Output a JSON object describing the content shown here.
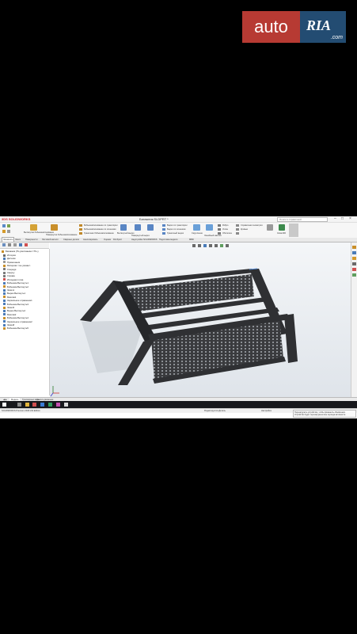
{
  "watermark": {
    "left": "auto",
    "right": "RIA",
    "domain": ".com"
  },
  "window": {
    "app_logo": "3DS SOLIDWORKS",
    "document_title": "Багажник.SLDPRT *",
    "search_placeholder": "Поиск в справочной",
    "controls": [
      "–",
      "□",
      "×"
    ]
  },
  "ribbon": {
    "buttons": [
      "Вытянутая бобышка/основание",
      "Повернутая бобышка/основание",
      "Бобышка/основание по траектории",
      "Бобышка/основание по сечениям",
      "Граничная бобышка/основание",
      "Вытянутый вырез",
      "Повернутый вырез",
      "Вырез по траектории",
      "Вырез по сечениям",
      "Граничный вырез",
      "Скругление",
      "Линейный массив",
      "Ребро",
      "Уклон",
      "Оболочка",
      "Справочная геометрия",
      "Кривые",
      "Instant3D"
    ]
  },
  "tabs": [
    "Элементы",
    "Эскиз",
    "Поверхности",
    "Листовой металл",
    "Сварные детали",
    "Анализировать",
    "Оценка",
    "DimXpert",
    "Надстройки SOLIDWORKS",
    "Подготовка модели",
    "MBD"
  ],
  "active_tab": "Элементы",
  "feature_tree": {
    "root": "Багажник (По умолчанию<<По у",
    "items": [
      "История",
      "Датчики",
      "Примечания",
      "Материал <не указан>",
      "Спереди",
      "Сверху",
      "Справа",
      "Исходная точка",
      "Бобышка-Вытянуть1",
      "Бобышка-Вытянуть2",
      "Эскиз1",
      "Вырез-Вытянуть1",
      "Массив1",
      "Зеркальное отражение1",
      "Бобышка-Вытянуть3",
      "Эскиз5",
      "Вырез-Вытянуть2",
      "Массив2",
      "Бобышка-Вытянуть4",
      "Зеркальное отражение2",
      "Эскиз8",
      "Бобышка-Вытянуть5"
    ]
  },
  "bottom_tabs": [
    "Модель",
    "Трехмерные виды",
    "Анализ движения"
  ],
  "active_bottom_tab": "Модель",
  "status": {
    "left": "SOLIDWORKS Premium 2018 x64 Edition",
    "mid": "Редактируется Деталь",
    "right": "Настройка"
  },
  "notification": "Перезагрузите устройство, чтобы применить обновления. Устройство будет перезагружено вне периода активности.",
  "colors": {
    "viewport_top": "#f4f6f8",
    "viewport_bottom": "#dfe4ea",
    "frame": "#2f3033",
    "accent": "#d6262f"
  }
}
